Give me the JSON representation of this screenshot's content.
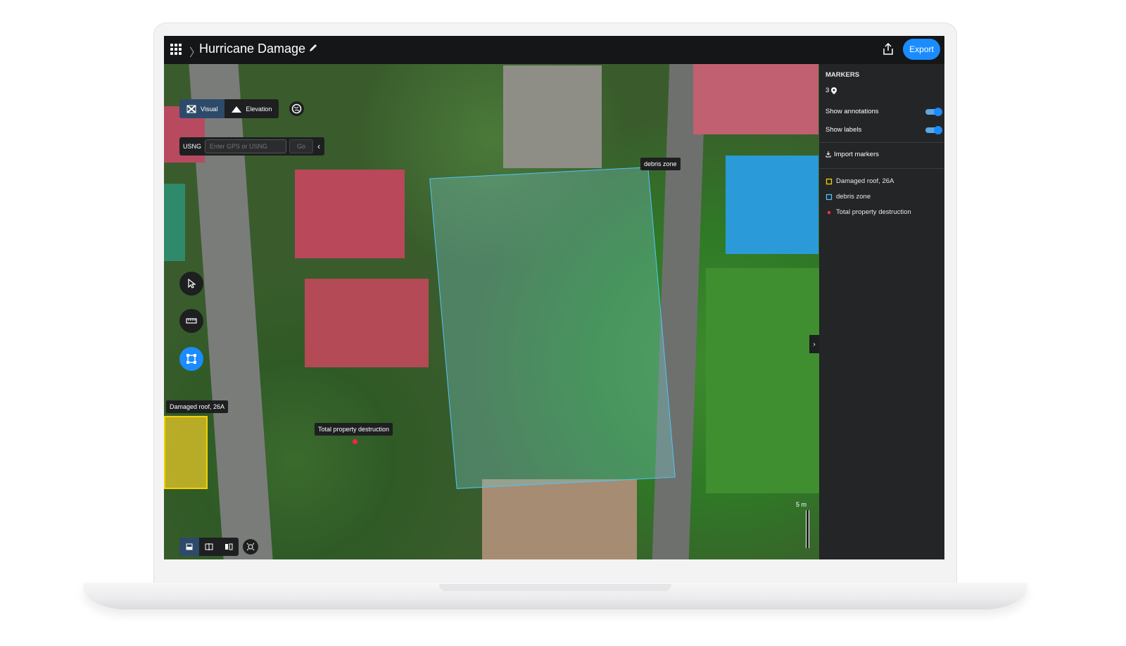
{
  "header": {
    "title": "Hurricane Damage",
    "export_label": "Export"
  },
  "map": {
    "mode_visual": "Visual",
    "mode_elevation": "Elevation",
    "usng_label": "USNG",
    "usng_placeholder": "Enter GPS or USNG",
    "usng_go": "Go",
    "labels": {
      "debris_zone": "debris zone",
      "damaged_roof": "Damaged roof, 26A",
      "total_destruction": "Total property destruction"
    },
    "scale_label": "5 m"
  },
  "sidebar": {
    "heading": "MARKERS",
    "count": "3",
    "show_annotations": "Show annotations",
    "show_labels": "Show labels",
    "show_annotations_on": true,
    "show_labels_on": true,
    "import_label": "Import markers",
    "markers": [
      {
        "label": "Damaged roof, 26A",
        "type": "polygon",
        "color": "#f5d000"
      },
      {
        "label": "debris zone",
        "type": "polygon",
        "color": "#4fc3f7"
      },
      {
        "label": "Total property destruction",
        "type": "point",
        "color": "#ff3344"
      }
    ]
  }
}
